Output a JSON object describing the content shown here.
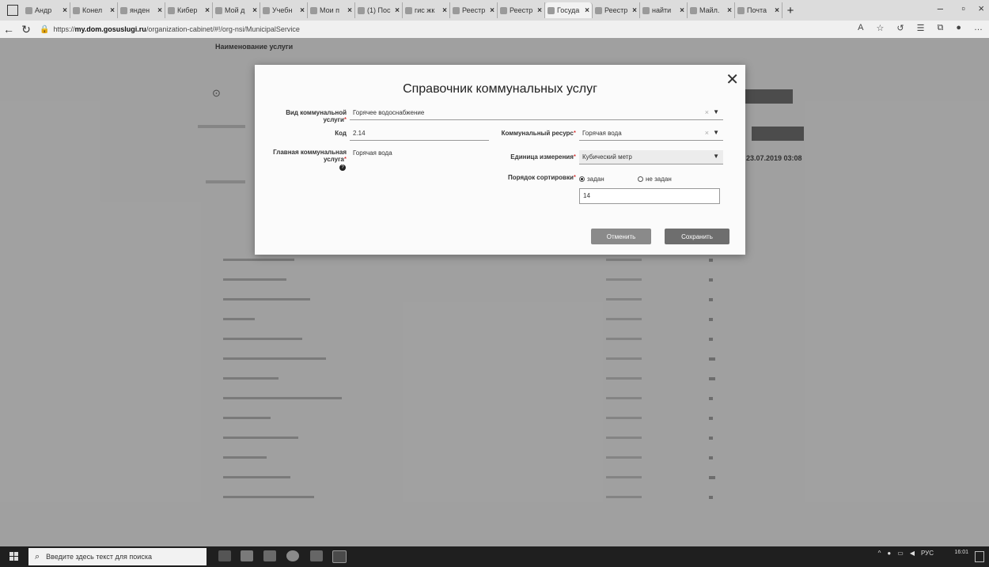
{
  "browser": {
    "tabs": [
      {
        "label": "Андр"
      },
      {
        "label": "Конел"
      },
      {
        "label": "янден"
      },
      {
        "label": "Кибер"
      },
      {
        "label": "Мой д"
      },
      {
        "label": "Учебн"
      },
      {
        "label": "Мои п"
      },
      {
        "label": "(1) Пос"
      },
      {
        "label": "гис жк"
      },
      {
        "label": "Реестр"
      },
      {
        "label": "Реестр"
      },
      {
        "label": "Госуда"
      },
      {
        "label": "Реестр"
      },
      {
        "label": "найти"
      },
      {
        "label": "Майл."
      },
      {
        "label": "Почта"
      }
    ],
    "active_tab_index": 11,
    "url_prefix": "https://",
    "url_host": "my.dom.gosuslugi.ru",
    "url_path": "/organization-cabinet/#!/org-nsi/MunicipalService"
  },
  "page": {
    "heading": "Наименование услуги",
    "date": "23.07.2019 03:08"
  },
  "modal": {
    "title": "Справочник коммунальных услуг",
    "service_type": {
      "label": "Вид коммунальной услуги",
      "value": "Горячее водоснабжение"
    },
    "code": {
      "label": "Код",
      "value": "2.14"
    },
    "main_service": {
      "label": "Главная коммунальная услуга",
      "value": "Горячая вода"
    },
    "resource": {
      "label": "Коммунальный ресурс",
      "value": "Горячая вода"
    },
    "unit": {
      "label": "Единица измерения",
      "value": "Кубический метр"
    },
    "sort": {
      "label": "Порядок сортировки",
      "option_set": "задан",
      "option_unset": "не задан",
      "value": "14",
      "selected": "задан"
    },
    "cancel_label": "Отменить",
    "save_label": "Сохранить"
  },
  "taskbar": {
    "search_placeholder": "Введите здесь текст для поиска",
    "lang": "РУС",
    "time": "16:01"
  },
  "colors": {
    "save_button": "#6e6e6e",
    "cancel_button": "#8a8a8a",
    "overlay": "#282828"
  }
}
